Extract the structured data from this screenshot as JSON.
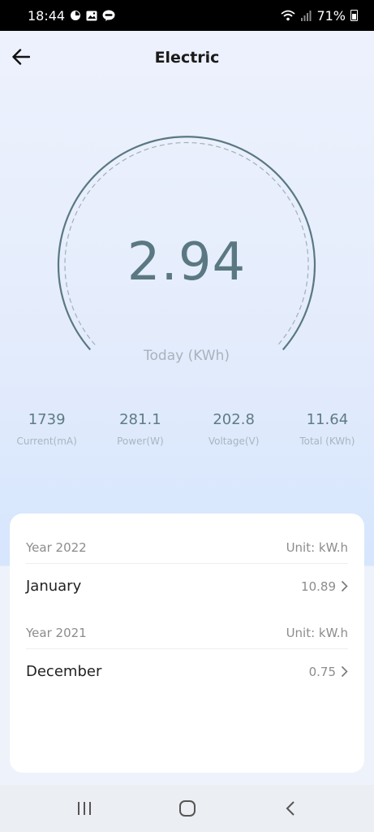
{
  "status_bar": {
    "time": "18:44",
    "battery": "71%",
    "icons": [
      "sync-icon",
      "gallery-icon",
      "line-chat-icon",
      "wifi-icon",
      "signal-icon",
      "battery-icon"
    ]
  },
  "header": {
    "title": "Electric",
    "back_icon": "arrow-left-icon"
  },
  "gauge": {
    "value": "2.94",
    "label": "Today (KWh)",
    "color": "#5a7882"
  },
  "stats": [
    {
      "value": "1739",
      "label": "Current(mA)"
    },
    {
      "value": "281.1",
      "label": "Power(W)"
    },
    {
      "value": "202.8",
      "label": "Voltage(V)"
    },
    {
      "value": "11.64",
      "label": "Total (KWh)"
    }
  ],
  "history": [
    {
      "year": "Year 2022",
      "unit": "Unit: kW.h",
      "months": [
        {
          "name": "January",
          "value": "10.89"
        }
      ]
    },
    {
      "year": "Year 2021",
      "unit": "Unit: kW.h",
      "months": [
        {
          "name": "December",
          "value": "0.75"
        }
      ]
    }
  ],
  "nav_bar": {
    "icons": [
      "recent-apps-icon",
      "home-icon",
      "back-icon"
    ]
  }
}
